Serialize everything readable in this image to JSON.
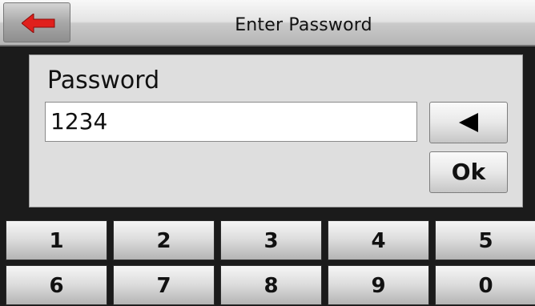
{
  "header": {
    "title": "Enter Password",
    "back_icon": "back-arrow-icon",
    "back_icon_color": "#e0201c"
  },
  "form": {
    "label": "Password",
    "value": "1234",
    "backspace_icon": "backspace-triangle-icon",
    "ok_label": "Ok"
  },
  "keypad": {
    "row1": [
      "1",
      "2",
      "3",
      "4",
      "5"
    ],
    "row2": [
      "6",
      "7",
      "8",
      "9",
      "0"
    ]
  }
}
